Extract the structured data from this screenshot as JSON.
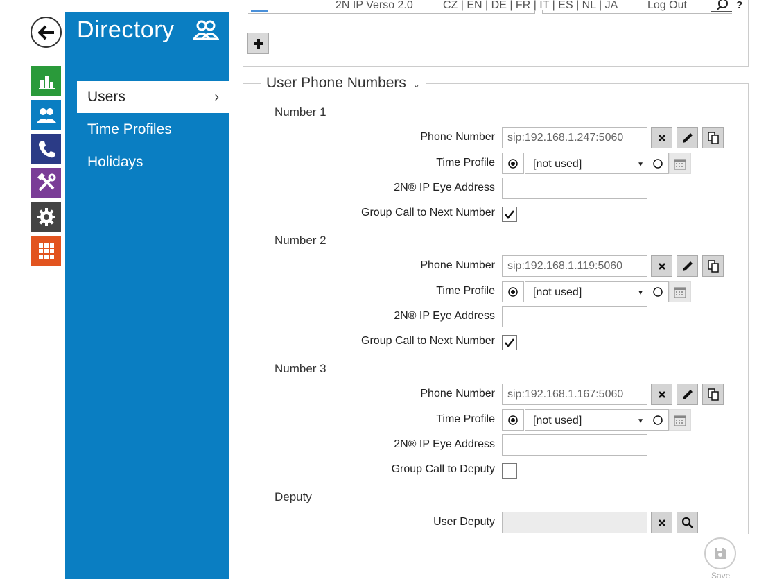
{
  "topbar": {
    "device": "2N IP Verso 2.0",
    "languages": "CZ | EN | DE | FR | IT | ES | NL | JA",
    "logout": "Log Out",
    "help": "?"
  },
  "sidebar": {
    "title": "Directory",
    "items": [
      {
        "label": "Users",
        "active": true
      },
      {
        "label": "Time Profiles",
        "active": false
      },
      {
        "label": "Holidays",
        "active": false
      }
    ]
  },
  "rail": {
    "colors": [
      "#2a9a3a",
      "#0a7ec2",
      "#2b3b86",
      "#7a3d97",
      "#444444",
      "#e2541f"
    ],
    "icons": [
      "bar-chart-icon",
      "users-icon",
      "phone-icon",
      "tools-icon",
      "gear-icon",
      "grid-icon"
    ]
  },
  "section": {
    "title": "User Phone Numbers",
    "numbers": [
      {
        "title": "Number 1",
        "phone_label": "Phone Number",
        "phone_value": "sip:192.168.1.247:5060",
        "time_label": "Time Profile",
        "time_value": "[not used]",
        "eye_label": "2N® IP Eye Address",
        "eye_value": "",
        "group_label": "Group Call to Next Number",
        "checked": true
      },
      {
        "title": "Number 2",
        "phone_label": "Phone Number",
        "phone_value": "sip:192.168.1.119:5060",
        "time_label": "Time Profile",
        "time_value": "[not used]",
        "eye_label": "2N® IP Eye Address",
        "eye_value": "",
        "group_label": "Group Call to Next Number",
        "checked": true
      },
      {
        "title": "Number 3",
        "phone_label": "Phone Number",
        "phone_value": "sip:192.168.1.167:5060",
        "time_label": "Time Profile",
        "time_value": "[not used]",
        "eye_label": "2N® IP Eye Address",
        "eye_value": "",
        "group_label": "Group Call to Deputy",
        "checked": false
      }
    ],
    "deputy": {
      "title": "Deputy",
      "label": "User Deputy",
      "value": ""
    }
  },
  "save": {
    "label": "Save"
  }
}
